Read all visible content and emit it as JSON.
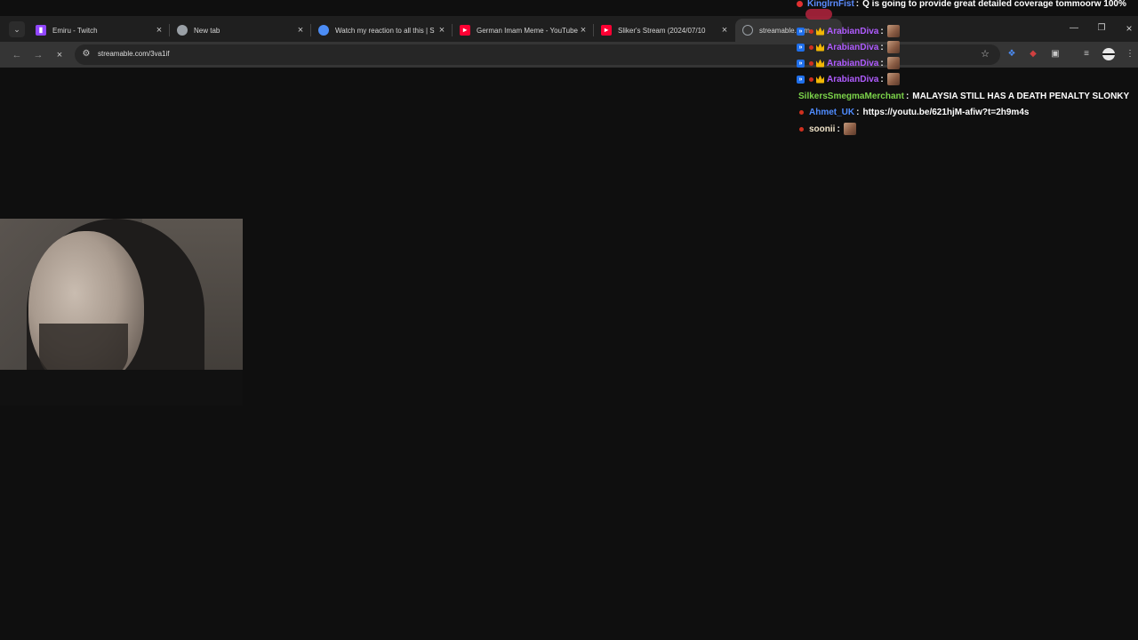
{
  "browser": {
    "tabs": [
      {
        "title": "Emiru - Twitch",
        "favicon": "twitch-icon",
        "color": "#9146ff"
      },
      {
        "title": "New tab",
        "favicon": "chrome-icon",
        "color": "#9aa0a6"
      },
      {
        "title": "Watch my reaction to all this | S",
        "favicon": "globe-icon",
        "color": "#4c8df6"
      },
      {
        "title": "German Imam Meme - YouTube",
        "favicon": "youtube-icon",
        "color": "#ff0033"
      },
      {
        "title": "Sliker's Stream (2024/07/10",
        "favicon": "youtube-icon",
        "color": "#ff0033"
      },
      {
        "title": "streamable.com",
        "favicon": "loading-icon",
        "color": "#9aa0a6"
      }
    ],
    "address": "streamable.com/3va1if"
  },
  "chat": {
    "messages": [
      {
        "user": "KingIrnFist",
        "user_color": "#5b8cff",
        "text": "Q is going to provide great detailed coverage tommoorw 100%"
      },
      {
        "user": "ArabianDiva",
        "user_color": "#b05cff",
        "text": ""
      },
      {
        "user": "ArabianDiva",
        "user_color": "#b05cff",
        "text": ""
      },
      {
        "user": "ArabianDiva",
        "user_color": "#b05cff",
        "text": ""
      },
      {
        "user": "ArabianDiva",
        "user_color": "#b05cff",
        "text": ""
      },
      {
        "user": "SilkersSmegmaMerchant",
        "user_color": "#7cd44a",
        "text": "MALAYSIA STILL HAS A DEATH PENALTY SLONKY"
      },
      {
        "user": "Ahmet_UK",
        "user_color": "#4f8cff",
        "text": "https://youtu.be/621hjM-afiw?t=2h9m4s"
      },
      {
        "user": "soonii",
        "user_color": "#f0e3c8",
        "text": ""
      }
    ],
    "separator": ":"
  }
}
